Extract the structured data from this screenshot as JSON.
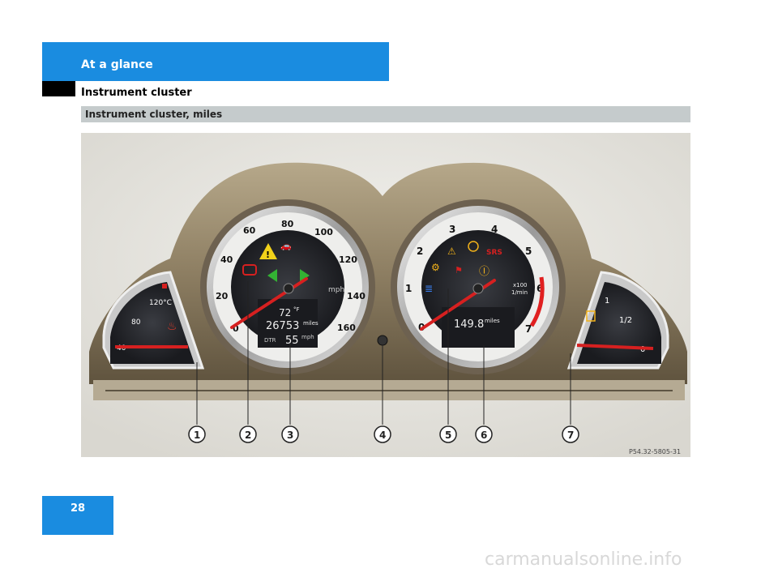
{
  "header": {
    "title": "At a glance"
  },
  "section_title": "Instrument cluster",
  "subsection_title": "Instrument cluster, miles",
  "page_number": "28",
  "watermark": "carmanualsonline.info",
  "figure": {
    "ref_code": "P54.32-5805-31",
    "speedometer": {
      "ticks": [
        "0",
        "20",
        "40",
        "60",
        "80",
        "100",
        "120",
        "140",
        "160"
      ],
      "unit": "mph",
      "temp_outside": "72",
      "temp_unit": "°F",
      "odometer": "26753",
      "odometer_unit": "miles",
      "dtr_label": "DTR",
      "dtr_value": "55",
      "dtr_unit": "mph"
    },
    "tachometer": {
      "ticks": [
        "0",
        "1",
        "2",
        "3",
        "4",
        "5",
        "6",
        "7"
      ],
      "scale_label_1": "x100",
      "scale_label_2": "1/min",
      "trip": "149.8",
      "trip_unit": "miles",
      "srs_label": "SRS"
    },
    "coolant": {
      "ticks": [
        "40",
        "80",
        "120°C"
      ]
    },
    "fuel": {
      "ticks": [
        "0",
        "1/2",
        "1"
      ]
    },
    "callouts": [
      "1",
      "2",
      "3",
      "4",
      "5",
      "6",
      "7"
    ]
  }
}
